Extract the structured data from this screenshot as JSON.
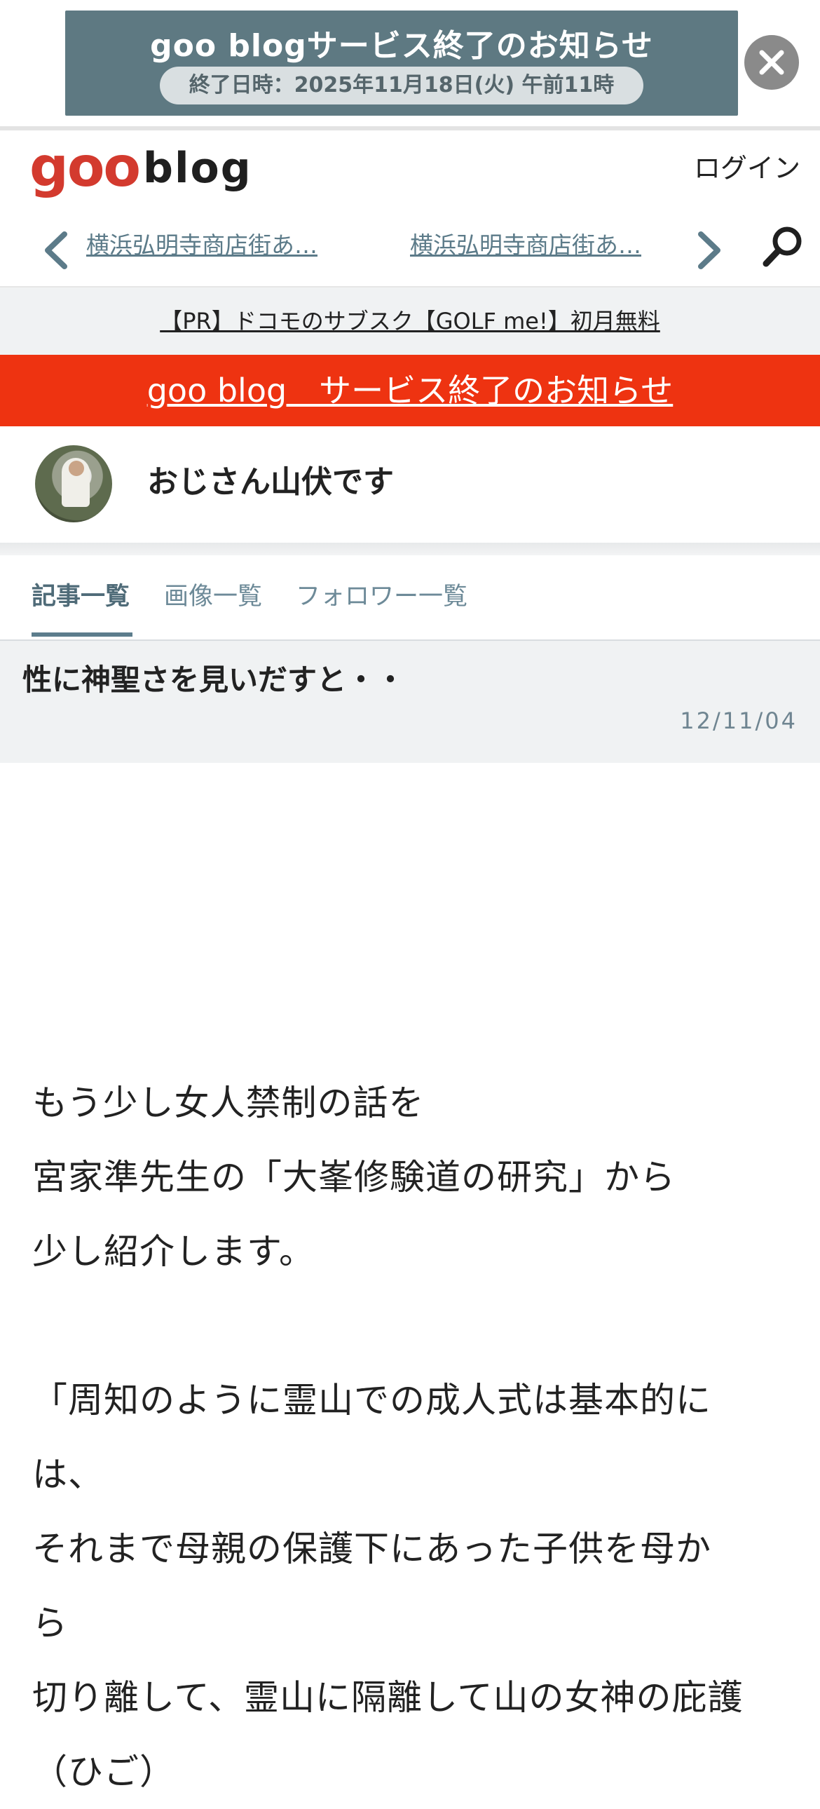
{
  "banner": {
    "title": "goo blogサービス終了のお知らせ",
    "date": "終了日時：2025年11月18日(火) 午前11時",
    "close_icon": "close-icon"
  },
  "header": {
    "logo_goo": "goo",
    "logo_blog": "blog",
    "login": "ログイン",
    "nav_links": [
      "横浜弘明寺商店街あ…",
      "横浜弘明寺商店街あ…"
    ],
    "icons": [
      "chevron-left-icon",
      "chevron-right-icon",
      "search-icon"
    ]
  },
  "pr": {
    "text": "【PR】ドコモのサブスク【GOLF me!】初月無料"
  },
  "notice": {
    "text": "goo blog　サービス終了のお知らせ",
    "color": "#ee3311"
  },
  "profile": {
    "name": "おじさん山伏です"
  },
  "tabs": [
    {
      "label": "記事一覧",
      "active": true
    },
    {
      "label": "画像一覧",
      "active": false
    },
    {
      "label": "フォロワー一覧",
      "active": false
    }
  ],
  "article": {
    "title": "性に神聖さを見いだすと・・",
    "date": "12/11/04",
    "lines": [
      "もう少し女人禁制の話を",
      "宮家準先生の「大峯修験道の研究」から",
      "少し紹介します。",
      "",
      "「周知のように霊山での成人式は基本的に",
      "は、",
      "それまで母親の保護下にあった子供を母か",
      "ら",
      "切り離して、霊山に隔離して山の女神の庇護",
      "（ひご）"
    ]
  },
  "colors": {
    "banner_bg": "#5e7982",
    "accent": "#5c7d8c",
    "logo_red": "#d33a2e"
  }
}
